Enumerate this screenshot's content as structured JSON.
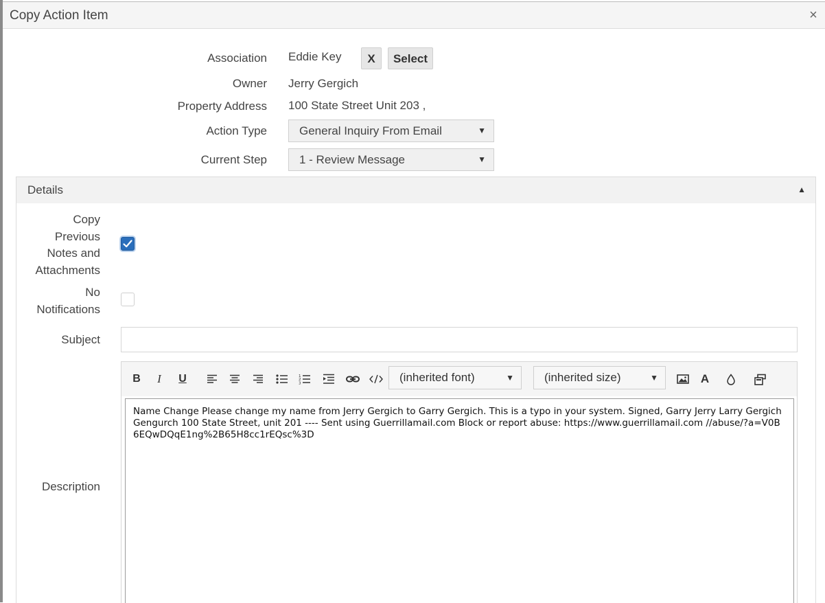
{
  "dialog": {
    "title": "Copy Action Item",
    "close_glyph": "×"
  },
  "form": {
    "association_label": "Association",
    "association_value": "Eddie Key",
    "clear_button": "X",
    "select_button": "Select",
    "owner_label": "Owner",
    "owner_value": "Jerry Gergich",
    "property_label": "Property Address",
    "property_value": "100 State Street Unit 203 ,",
    "action_type_label": "Action Type",
    "action_type_value": "General Inquiry From Email",
    "current_step_label": "Current Step",
    "current_step_value": "1 - Review Message"
  },
  "details": {
    "title": "Details",
    "toggle_glyph": "▲",
    "copy_notes_label_lines": [
      "Copy",
      "Previous",
      "Notes and",
      "Attachments"
    ],
    "copy_notes_checked": true,
    "no_notifications_label_lines": [
      "No",
      "Notifications"
    ],
    "no_notifications_checked": false,
    "subject_label": "Subject",
    "subject_value": "",
    "description_label": "Description",
    "description_value": "Name Change Please change my name from Jerry Gergich to Garry Gergich. This is a typo in your system. Signed, Garry Jerry Larry Gergich Gengurch 100 State Street, unit 201 ---- Sent using Guerrillamail.com Block or report abuse: https://www.guerrillamail.com //abuse/?a=V0B6EQwDQqE1ng%2B65H8cc1rEQsc%3D"
  },
  "toolbar": {
    "bold": "B",
    "italic": "I",
    "underline": "U",
    "font_label": "(inherited font)",
    "size_label": "(inherited size)",
    "font_color": "A",
    "icons": [
      "align-left-icon",
      "align-center-icon",
      "align-right-icon",
      "bullet-list-icon",
      "numbered-list-icon",
      "indent-icon",
      "link-icon",
      "code-icon",
      "image-icon",
      "font-color-icon",
      "background-color-icon",
      "format-painter-icon"
    ]
  },
  "colors": {
    "checkbox_checked": "#2a6ebb",
    "header_bg": "#f5f5f5"
  }
}
